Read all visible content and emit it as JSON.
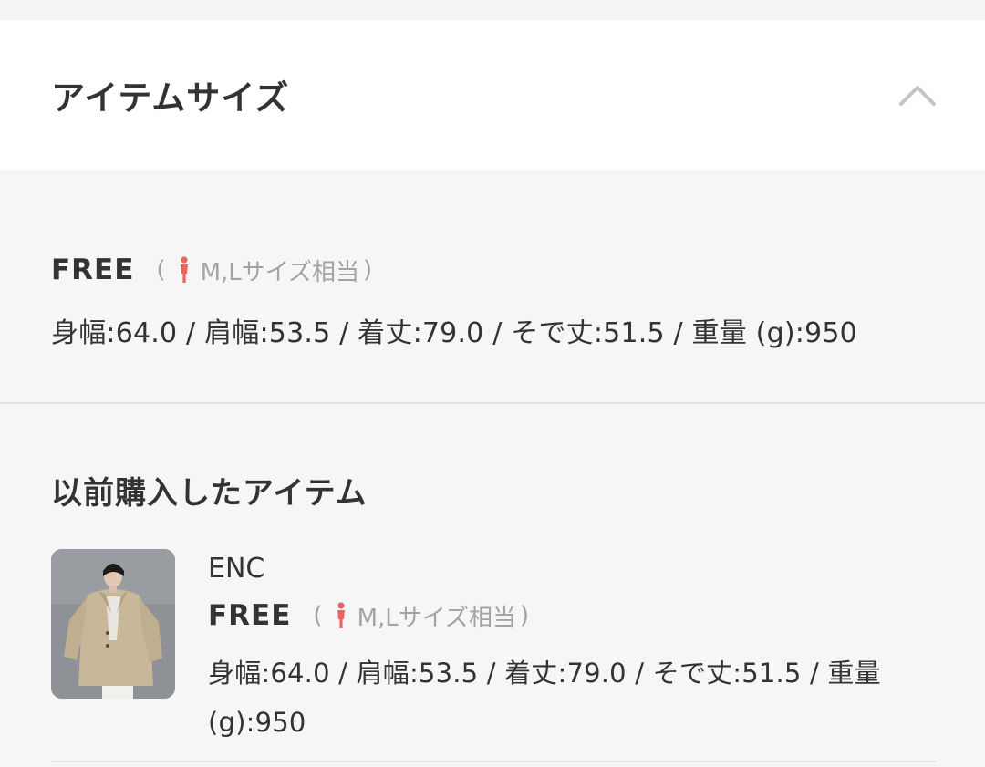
{
  "header": {
    "title": "アイテムサイズ",
    "toggle_icon": "chevron-up-icon"
  },
  "size_info": {
    "name": "FREE",
    "paren_open": "(",
    "note": "M,Lサイズ相当",
    "paren_close": ")",
    "person_icon": "female-person-icon",
    "measurements": "身幅:64.0 / 肩幅:53.5 / 着丈:79.0 / そで丈:51.5 / 重量 (g):950"
  },
  "history": {
    "title": "以前購入したアイテム",
    "items": [
      {
        "brand": "ENC",
        "size_name": "FREE",
        "paren_open": "(",
        "note": "M,Lサイズ相当",
        "paren_close": ")",
        "measurements": "身幅:64.0 / 肩幅:53.5 / 着丈:79.0 / そで丈:51.5 / 重量 (g):950"
      }
    ]
  },
  "colors": {
    "accent_person": "#e8665f",
    "text": "#333333",
    "muted": "#a3a3a3"
  }
}
